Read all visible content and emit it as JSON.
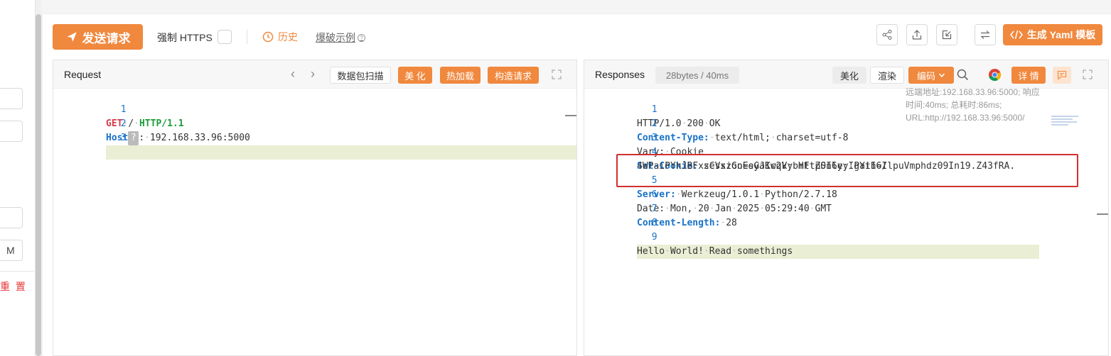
{
  "sidebar": {
    "m_label": "M",
    "reset_label": "重 置"
  },
  "toolbar": {
    "send_label": "发送请求",
    "https_label": "强制 HTTPS",
    "history_label": "历史",
    "examples_label": "爆破示例",
    "yaml_label": "生成 Yaml 模板"
  },
  "request": {
    "title": "Request",
    "actions": [
      "数据包扫描",
      "美 化",
      "热加载",
      "构造请求"
    ],
    "lines": [
      {
        "num": "1",
        "method": "GET",
        "path": "/",
        "proto": "HTTP/1.1"
      },
      {
        "num": "2",
        "key": "Host",
        "badge": "?",
        "value": "192.168.33.96:5000"
      },
      {
        "num": "3"
      }
    ]
  },
  "response": {
    "title": "Responses",
    "size_badge": "28bytes / 40ms",
    "beautify_label": "美化",
    "render_label": "渲染",
    "encoding_label": "编码",
    "detail_label": "详 情",
    "meta_text": "远端地址:192.168.33.96:5000; 响应时间:40ms; 总耗时:86ms; URL:http://192.168.33.96:5000/",
    "lines": [
      {
        "num": "1",
        "text": "HTTP/1.0 200 OK"
      },
      {
        "num": "2",
        "key": "Content-Type:",
        "value": "text/html; charset=utf-8"
      },
      {
        "num": "3",
        "plain_key": "Vary:",
        "value": "Cookie"
      },
      {
        "num": "4",
        "key": "Set-Cookie:",
        "value": "session=eyJ1c2VybmFtZSI6eyIgYiI6IlpuVmphdz09In19.Z43fRA.",
        "value2": "4WPaiPYhJBFxzCVxzGoEsGaKwqk; HttpOnly; Path=/"
      },
      {
        "num": "5",
        "key": "Server:",
        "value": "Werkzeug/1.0.1 Python/2.7.18"
      },
      {
        "num": "6",
        "plain_key": "Date:",
        "value": "Mon, 20 Jan 2025 05:29:40 GMT"
      },
      {
        "num": "7",
        "key": "Content-Length:",
        "value": "28"
      },
      {
        "num": "8"
      },
      {
        "num": "9",
        "text": "Hello World! Read somethings"
      }
    ]
  },
  "colors": {
    "accent": "#f0883e",
    "highlight_box": "#d32f2f"
  }
}
